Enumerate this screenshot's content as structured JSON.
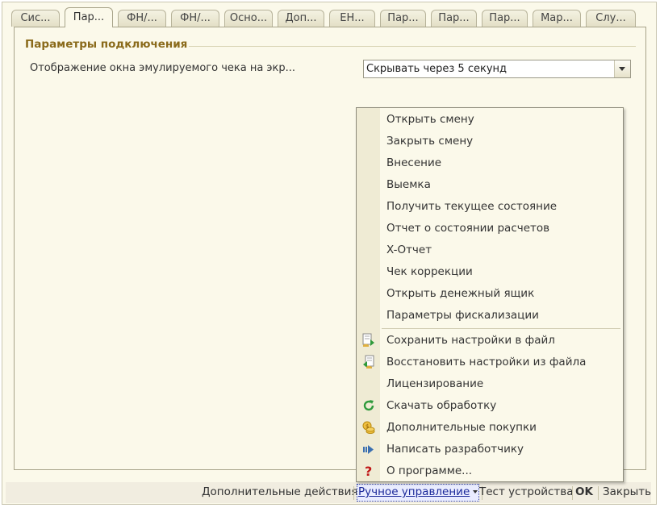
{
  "tabs": [
    {
      "label": "Сис..."
    },
    {
      "label": "Пар...",
      "active": true
    },
    {
      "label": "ФН/..."
    },
    {
      "label": "ФН/..."
    },
    {
      "label": "Осно..."
    },
    {
      "label": "Доп..."
    },
    {
      "label": "ЕН..."
    },
    {
      "label": "Пар..."
    },
    {
      "label": "Пар..."
    },
    {
      "label": "Пар..."
    },
    {
      "label": "Мар..."
    },
    {
      "label": "Слу..."
    }
  ],
  "section": {
    "title": "Параметры подключения"
  },
  "field": {
    "label": "Отображение окна эмулируемого чека на экр...",
    "value": "Скрывать через 5 секунд"
  },
  "menu": {
    "items": [
      {
        "label": "Открыть смену"
      },
      {
        "label": "Закрыть смену"
      },
      {
        "label": "Внесение"
      },
      {
        "label": "Выемка"
      },
      {
        "label": "Получить текущее состояние"
      },
      {
        "label": "Отчет о состоянии расчетов"
      },
      {
        "label": "X-Отчет"
      },
      {
        "label": "Чек коррекции"
      },
      {
        "label": "Открыть денежный ящик"
      },
      {
        "label": "Параметры фискализации"
      },
      {
        "label": "Сохранить настройки в файл",
        "icon": "save-settings-icon"
      },
      {
        "label": "Восстановить настройки из файла",
        "icon": "restore-settings-icon"
      },
      {
        "label": "Лицензирование"
      },
      {
        "label": "Скачать обработку",
        "icon": "refresh-icon"
      },
      {
        "label": "Дополнительные покупки",
        "icon": "coins-icon"
      },
      {
        "label": "Написать разработчику",
        "icon": "send-icon"
      },
      {
        "label": "О программе...",
        "icon": "question-icon"
      }
    ]
  },
  "bottombar": {
    "additional_actions": "Дополнительные действия",
    "manual_control": "Ручное управление",
    "test_device": "Тест устройства",
    "ok": "OK",
    "close": "Закрыть"
  },
  "colors": {
    "background": "#fbf9ea",
    "section_title": "#8a6a1a",
    "active_link": "#1c2a9a"
  }
}
